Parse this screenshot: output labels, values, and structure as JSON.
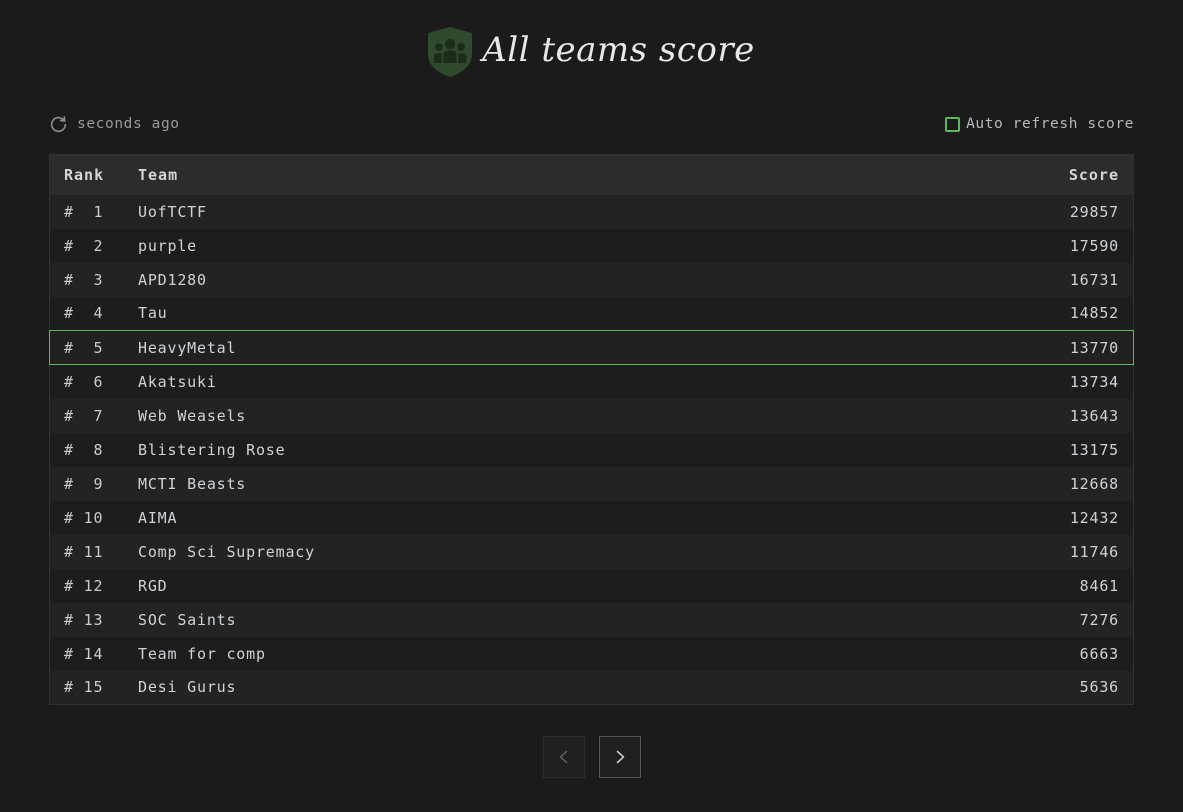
{
  "header": {
    "title": "All teams score",
    "logo_icon": "team-shield-icon",
    "shield_color": "#2f4a2c",
    "figure_color": "#1d2b1b"
  },
  "toolbar": {
    "refresh_icon": "refresh-icon",
    "refresh_label": "seconds ago",
    "auto_refresh_label": "Auto refresh score",
    "auto_refresh_checked": false,
    "checkbox_color": "#5cb85c"
  },
  "table": {
    "columns": {
      "rank": "Rank",
      "team": "Team",
      "score": "Score"
    },
    "highlight_color": "#5cb85c",
    "rows": [
      {
        "rank": "#  1",
        "team": "UofTCTF",
        "score": "29857",
        "highlight": false
      },
      {
        "rank": "#  2",
        "team": "purple",
        "score": "17590",
        "highlight": false
      },
      {
        "rank": "#  3",
        "team": "APD1280",
        "score": "16731",
        "highlight": false
      },
      {
        "rank": "#  4",
        "team": "Tau",
        "score": "14852",
        "highlight": false
      },
      {
        "rank": "#  5",
        "team": "HeavyMetal",
        "score": "13770",
        "highlight": true
      },
      {
        "rank": "#  6",
        "team": "Akatsuki",
        "score": "13734",
        "highlight": false
      },
      {
        "rank": "#  7",
        "team": "Web Weasels",
        "score": "13643",
        "highlight": false
      },
      {
        "rank": "#  8",
        "team": "Blistering Rose",
        "score": "13175",
        "highlight": false
      },
      {
        "rank": "#  9",
        "team": "MCTI Beasts",
        "score": "12668",
        "highlight": false
      },
      {
        "rank": "# 10",
        "team": "AIMA",
        "score": "12432",
        "highlight": false
      },
      {
        "rank": "# 11",
        "team": "Comp Sci Supremacy",
        "score": "11746",
        "highlight": false
      },
      {
        "rank": "# 12",
        "team": "RGD",
        "score": "8461",
        "highlight": false
      },
      {
        "rank": "# 13",
        "team": "SOC Saints",
        "score": "7276",
        "highlight": false
      },
      {
        "rank": "# 14",
        "team": "Team for comp",
        "score": "6663",
        "highlight": false
      },
      {
        "rank": "# 15",
        "team": "Desi Gurus",
        "score": "5636",
        "highlight": false
      }
    ]
  },
  "pagination": {
    "prev_icon": "chevron-left-icon",
    "next_icon": "chevron-right-icon",
    "prev_enabled": false,
    "next_enabled": true
  }
}
